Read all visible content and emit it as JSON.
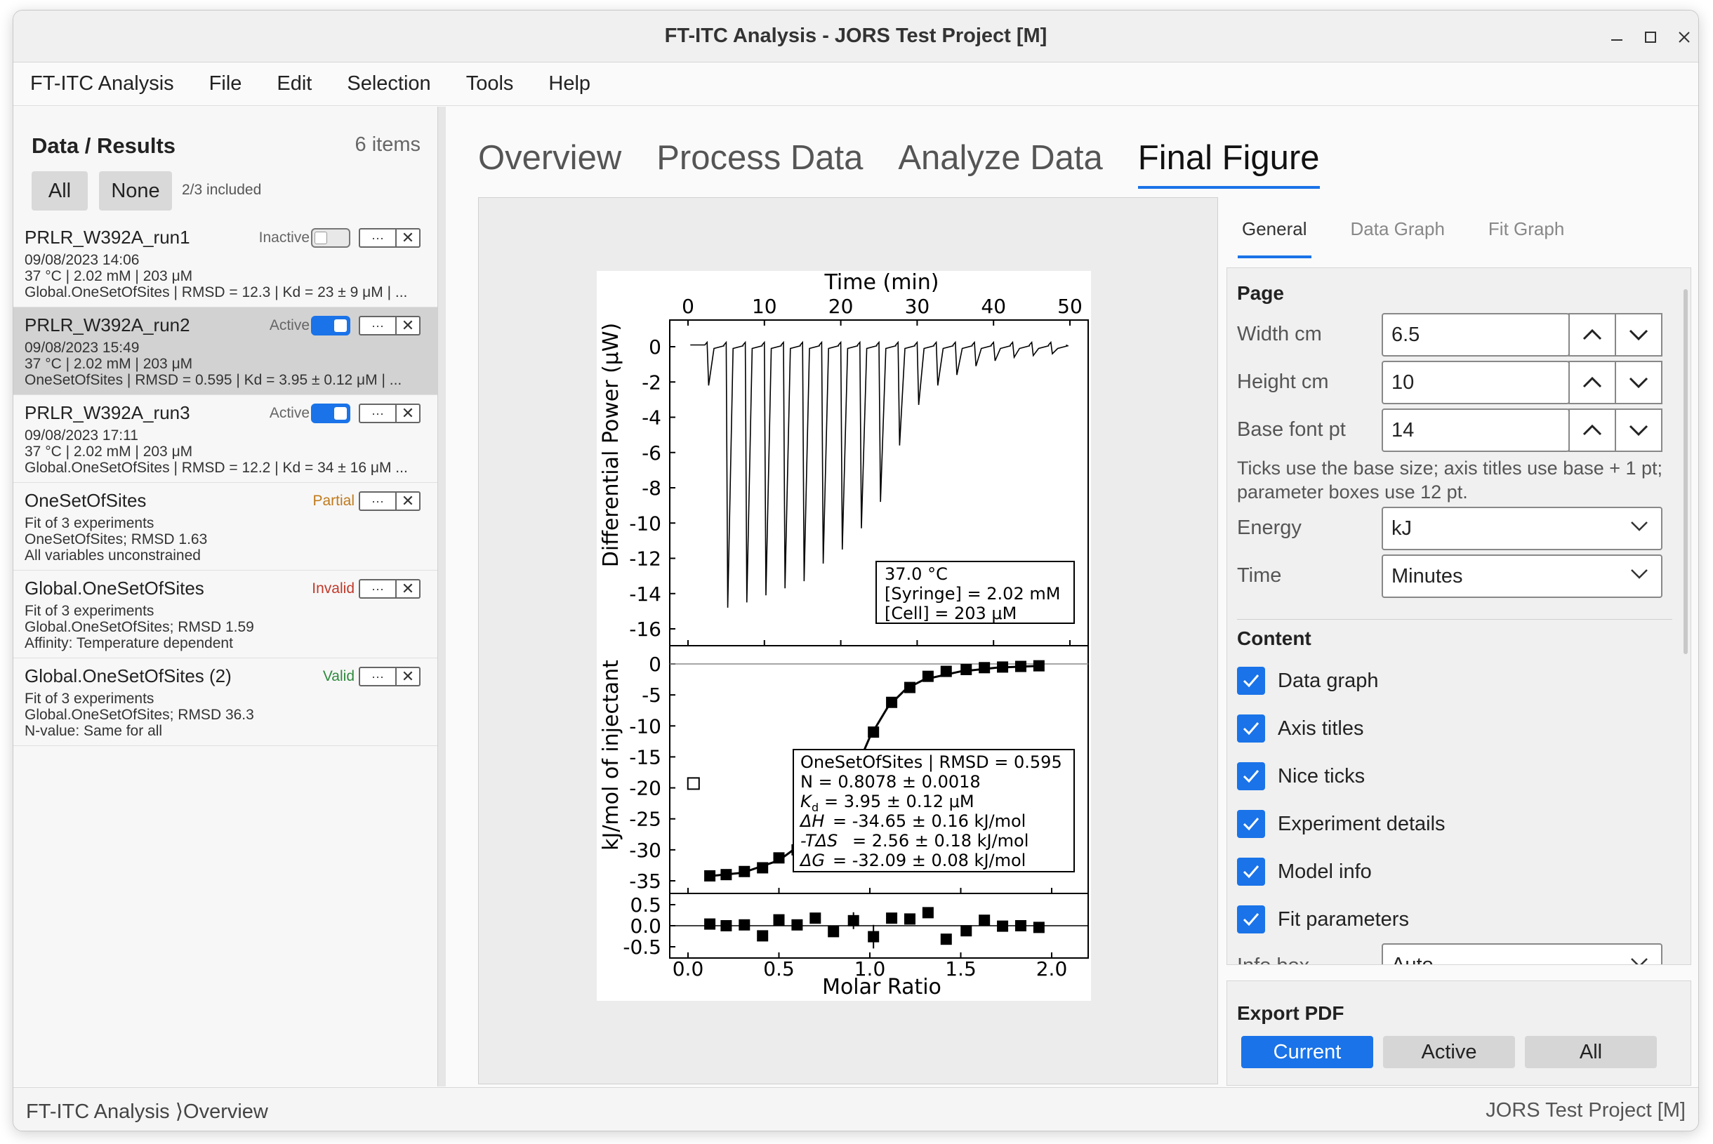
{
  "window": {
    "title": "FT-ITC Analysis - JORS Test Project [M]"
  },
  "menu": [
    "FT-ITC Analysis",
    "File",
    "Edit",
    "Selection",
    "Tools",
    "Help"
  ],
  "sidebar": {
    "title": "Data / Results",
    "count": "6 items",
    "all_label": "All",
    "none_label": "None",
    "included": "2/3 included",
    "items": [
      {
        "name": "PRLR_W392A_run1",
        "status": "Inactive",
        "line1": "09/08/2023 14:06",
        "line2": "37 °C | 2.02 mM | 203 μM",
        "line3": "Global.OneSetOfSites | RMSD = 12.3 | Kd = 23 ± 9 μM | ..."
      },
      {
        "name": "PRLR_W392A_run2",
        "status": "Active",
        "line1": "09/08/2023 15:49",
        "line2": "37 °C | 2.02 mM | 203 μM",
        "line3": "OneSetOfSites | RMSD = 0.595 | Kd = 3.95 ± 0.12 μM | ..."
      },
      {
        "name": "PRLR_W392A_run3",
        "status": "Active",
        "line1": "09/08/2023 17:11",
        "line2": "37 °C | 2.02 mM | 203 μM",
        "line3": "Global.OneSetOfSites | RMSD = 12.2 | Kd = 34 ± 16 μM ..."
      },
      {
        "name": "OneSetOfSites",
        "status": "Partial",
        "line1": "Fit of 3 experiments",
        "line2": "OneSetOfSites; RMSD 1.63",
        "line3": "All variables unconstrained"
      },
      {
        "name": "Global.OneSetOfSites",
        "status": "Invalid",
        "line1": "Fit of 3 experiments",
        "line2": "Global.OneSetOfSites; RMSD 1.59",
        "line3": "Affinity: Temperature dependent"
      },
      {
        "name": "Global.OneSetOfSites (2)",
        "status": "Valid",
        "line1": "Fit of 3 experiments",
        "line2": "Global.OneSetOfSites; RMSD 36.3",
        "line3": "N-value: Same for all"
      }
    ],
    "more_glyph": "···",
    "delete_glyph": "✕"
  },
  "tabs": [
    "Overview",
    "Process Data",
    "Analyze Data",
    "Final Figure"
  ],
  "right_tabs": [
    "General",
    "Data Graph",
    "Fit Graph"
  ],
  "panel": {
    "page_title": "Page",
    "width_label": "Width cm",
    "width_value": "6.5",
    "height_label": "Height cm",
    "height_value": "10",
    "font_label": "Base font pt",
    "font_value": "14",
    "hint": "Ticks use the base size; axis titles use base + 1 pt; parameter boxes use 12 pt.",
    "energy_label": "Energy",
    "energy_value": "kJ",
    "time_label": "Time",
    "time_value": "Minutes",
    "content_title": "Content",
    "checks": [
      "Data graph",
      "Axis titles",
      "Nice ticks",
      "Experiment details",
      "Model info",
      "Fit parameters"
    ],
    "infobox_label": "Info box",
    "infobox_value": "Auto"
  },
  "export": {
    "title": "Export PDF",
    "buttons": [
      "Current",
      "Active",
      "All"
    ]
  },
  "status": {
    "left": "FT-ITC Analysis ⟩Overview",
    "right": "JORS Test Project [M]"
  },
  "figure": {
    "top_xlabel": "Time (min)",
    "top_xticks": [
      "0",
      "10",
      "20",
      "30",
      "40",
      "50"
    ],
    "thermo_ylabel": "Differential Power (μW)",
    "thermo_yticks": [
      "0",
      "-2",
      "-4",
      "-6",
      "-8",
      "-10",
      "-12",
      "-14",
      "-16"
    ],
    "exp_box": [
      "37.0 °C",
      "[Syringe] = 2.02 mM",
      "[Cell] = 203 μM"
    ],
    "iso_ylabel": "kJ/mol of injectant",
    "iso_yticks": [
      "0",
      "-5",
      "-10",
      "-15",
      "-20",
      "-25",
      "-30",
      "-35"
    ],
    "fit_box": [
      "OneSetOfSites | RMSD = 0.595",
      "N = 0.8078 ± 0.0018",
      "= 3.95 ± 0.12 μM",
      "= -34.65 ± 0.16 kJ/mol",
      "= 2.56 ± 0.18 kJ/mol",
      "= -32.09 ± 0.08 kJ/mol"
    ],
    "fit_box_symbols": [
      "K",
      "d",
      "ΔH",
      "-TΔS",
      "ΔG"
    ],
    "res_yticks": [
      "0.5",
      "0.0",
      "-0.5"
    ],
    "bottom_xticks": [
      "0.0",
      "0.5",
      "1.0",
      "1.5",
      "2.0"
    ],
    "bottom_xlabel": "Molar Ratio"
  },
  "chart_data": [
    {
      "type": "line",
      "title": "",
      "xlabel": "Time (min)",
      "ylabel": "Differential Power (μW)",
      "xlim": [
        0,
        50
      ],
      "ylim": [
        -16,
        1
      ],
      "injection_times_min": [
        2.5,
        5,
        7.5,
        10,
        12.5,
        15,
        17.5,
        20,
        22.5,
        25,
        27.5,
        30,
        32.5,
        35,
        37.5,
        40,
        42.5,
        45,
        47.5
      ],
      "peak_minima_uW": [
        -2.2,
        -14.8,
        -14.5,
        -14.1,
        -13.7,
        -13.3,
        -12.3,
        -11.5,
        -10.3,
        -8.8,
        -5.6,
        -3.3,
        -2.2,
        -1.6,
        -1.1,
        -0.8,
        -0.6,
        -0.5,
        -0.4
      ]
    },
    {
      "type": "scatter",
      "xlabel": "Molar Ratio",
      "ylabel": "kJ/mol of injectant",
      "xlim": [
        -0.05,
        2.1
      ],
      "ylim": [
        -37,
        1
      ],
      "series": [
        {
          "x": [
            0.03
          ],
          "y": [
            -19.3
          ],
          "marker": "open-square"
        },
        {
          "x": [
            0.12,
            0.21,
            0.31,
            0.41,
            0.5,
            0.6,
            0.7,
            0.8,
            0.91,
            1.02,
            1.12,
            1.22,
            1.32,
            1.42,
            1.53,
            1.63,
            1.73,
            1.83,
            1.93
          ],
          "y": [
            -34.2,
            -34.0,
            -33.5,
            -32.9,
            -31.3,
            -30.0,
            -27.6,
            -23.5,
            -18.9,
            -11.0,
            -6.2,
            -3.8,
            -2.0,
            -1.2,
            -0.9,
            -0.6,
            -0.5,
            -0.4,
            -0.3
          ],
          "marker": "filled-square"
        }
      ],
      "fit_line": {
        "x": [
          0.1,
          0.3,
          0.5,
          0.7,
          0.8,
          0.9,
          1.0,
          1.1,
          1.2,
          1.3,
          1.5,
          1.7,
          1.95
        ],
        "y": [
          -34.3,
          -33.7,
          -31.7,
          -27.4,
          -23.6,
          -18.6,
          -11.8,
          -6.9,
          -4.0,
          -2.5,
          -1.2,
          -0.6,
          -0.3
        ]
      }
    },
    {
      "type": "scatter",
      "ylabel": "",
      "xlim": [
        -0.05,
        2.1
      ],
      "ylim": [
        -0.7,
        0.7
      ],
      "residuals": {
        "x": [
          0.12,
          0.21,
          0.31,
          0.41,
          0.5,
          0.6,
          0.7,
          0.8,
          0.91,
          1.02,
          1.12,
          1.22,
          1.32,
          1.42,
          1.53,
          1.63,
          1.73,
          1.83,
          1.93
        ],
        "y": [
          0.04,
          0.0,
          0.02,
          -0.24,
          0.14,
          0.02,
          0.18,
          -0.14,
          0.12,
          -0.26,
          0.18,
          0.16,
          0.31,
          -0.32,
          -0.12,
          0.13,
          -0.01,
          0.0,
          -0.04
        ]
      }
    }
  ]
}
